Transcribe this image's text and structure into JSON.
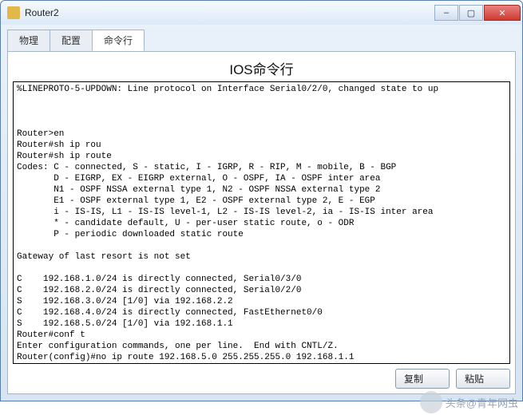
{
  "window": {
    "title": "Router2",
    "min_tip": "–",
    "max_tip": "▢",
    "close_tip": "✕"
  },
  "tabs": {
    "t0": "物理",
    "t1": "配置",
    "t2": "命令行"
  },
  "panel": {
    "heading": "IOS命令行"
  },
  "terminal": {
    "text": "%LINEPROTO-5-UPDOWN: Line protocol on Interface Serial0/2/0, changed state to up\n\n\n\nRouter>en\nRouter#sh ip rou\nRouter#sh ip route\nCodes: C - connected, S - static, I - IGRP, R - RIP, M - mobile, B - BGP\n       D - EIGRP, EX - EIGRP external, O - OSPF, IA - OSPF inter area\n       N1 - OSPF NSSA external type 1, N2 - OSPF NSSA external type 2\n       E1 - OSPF external type 1, E2 - OSPF external type 2, E - EGP\n       i - IS-IS, L1 - IS-IS level-1, L2 - IS-IS level-2, ia - IS-IS inter area\n       * - candidate default, U - per-user static route, o - ODR\n       P - periodic downloaded static route\n\nGateway of last resort is not set\n\nC    192.168.1.0/24 is directly connected, Serial0/3/0\nC    192.168.2.0/24 is directly connected, Serial0/2/0\nS    192.168.3.0/24 [1/0] via 192.168.2.2\nC    192.168.4.0/24 is directly connected, FastEthernet0/0\nS    192.168.5.0/24 [1/0] via 192.168.1.1\nRouter#conf t\nEnter configuration commands, one per line.  End with CNTL/Z.\nRouter(config)#no ip route 192.168.5.0 255.255.255.0 192.168.1.1\nRouter(config)#"
  },
  "buttons": {
    "copy": "复制",
    "paste": "粘贴"
  },
  "watermark": {
    "text": "头条@青年网虫"
  }
}
